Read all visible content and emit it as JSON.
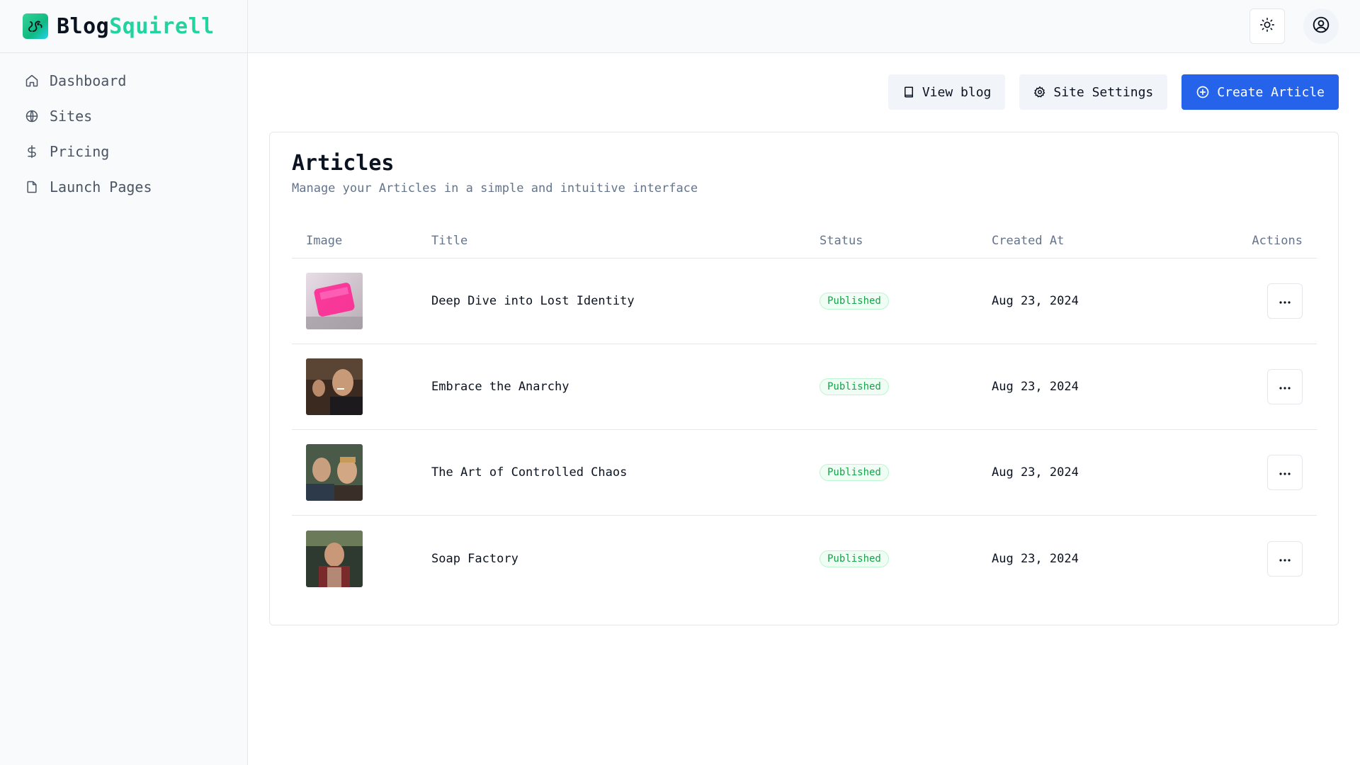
{
  "brand": {
    "name_part1": "Blog",
    "name_part2": "Squirell",
    "logo_icon": "squirrel-icon",
    "accent": "#22d3a0"
  },
  "sidebar": {
    "items": [
      {
        "label": "Dashboard",
        "icon": "home-icon"
      },
      {
        "label": "Sites",
        "icon": "globe-icon"
      },
      {
        "label": "Pricing",
        "icon": "dollar-icon"
      },
      {
        "label": "Launch Pages",
        "icon": "file-icon"
      }
    ]
  },
  "header": {
    "theme_icon": "sun-icon",
    "user_icon": "user-circle-icon"
  },
  "toolbar": {
    "view_blog_label": "View blog",
    "site_settings_label": "Site Settings",
    "create_article_label": "Create Article",
    "primary_color": "#2563eb"
  },
  "articles": {
    "title": "Articles",
    "subtitle": "Manage your Articles in a simple and intuitive interface",
    "columns": {
      "image": "Image",
      "title": "Title",
      "status": "Status",
      "created_at": "Created At",
      "actions": "Actions"
    },
    "rows": [
      {
        "title": "Deep Dive into Lost Identity",
        "status": "Published",
        "created_at": "Aug 23, 2024"
      },
      {
        "title": "Embrace the Anarchy",
        "status": "Published",
        "created_at": "Aug 23, 2024"
      },
      {
        "title": "The Art of Controlled Chaos",
        "status": "Published",
        "created_at": "Aug 23, 2024"
      },
      {
        "title": "Soap Factory",
        "status": "Published",
        "created_at": "Aug 23, 2024"
      }
    ]
  }
}
